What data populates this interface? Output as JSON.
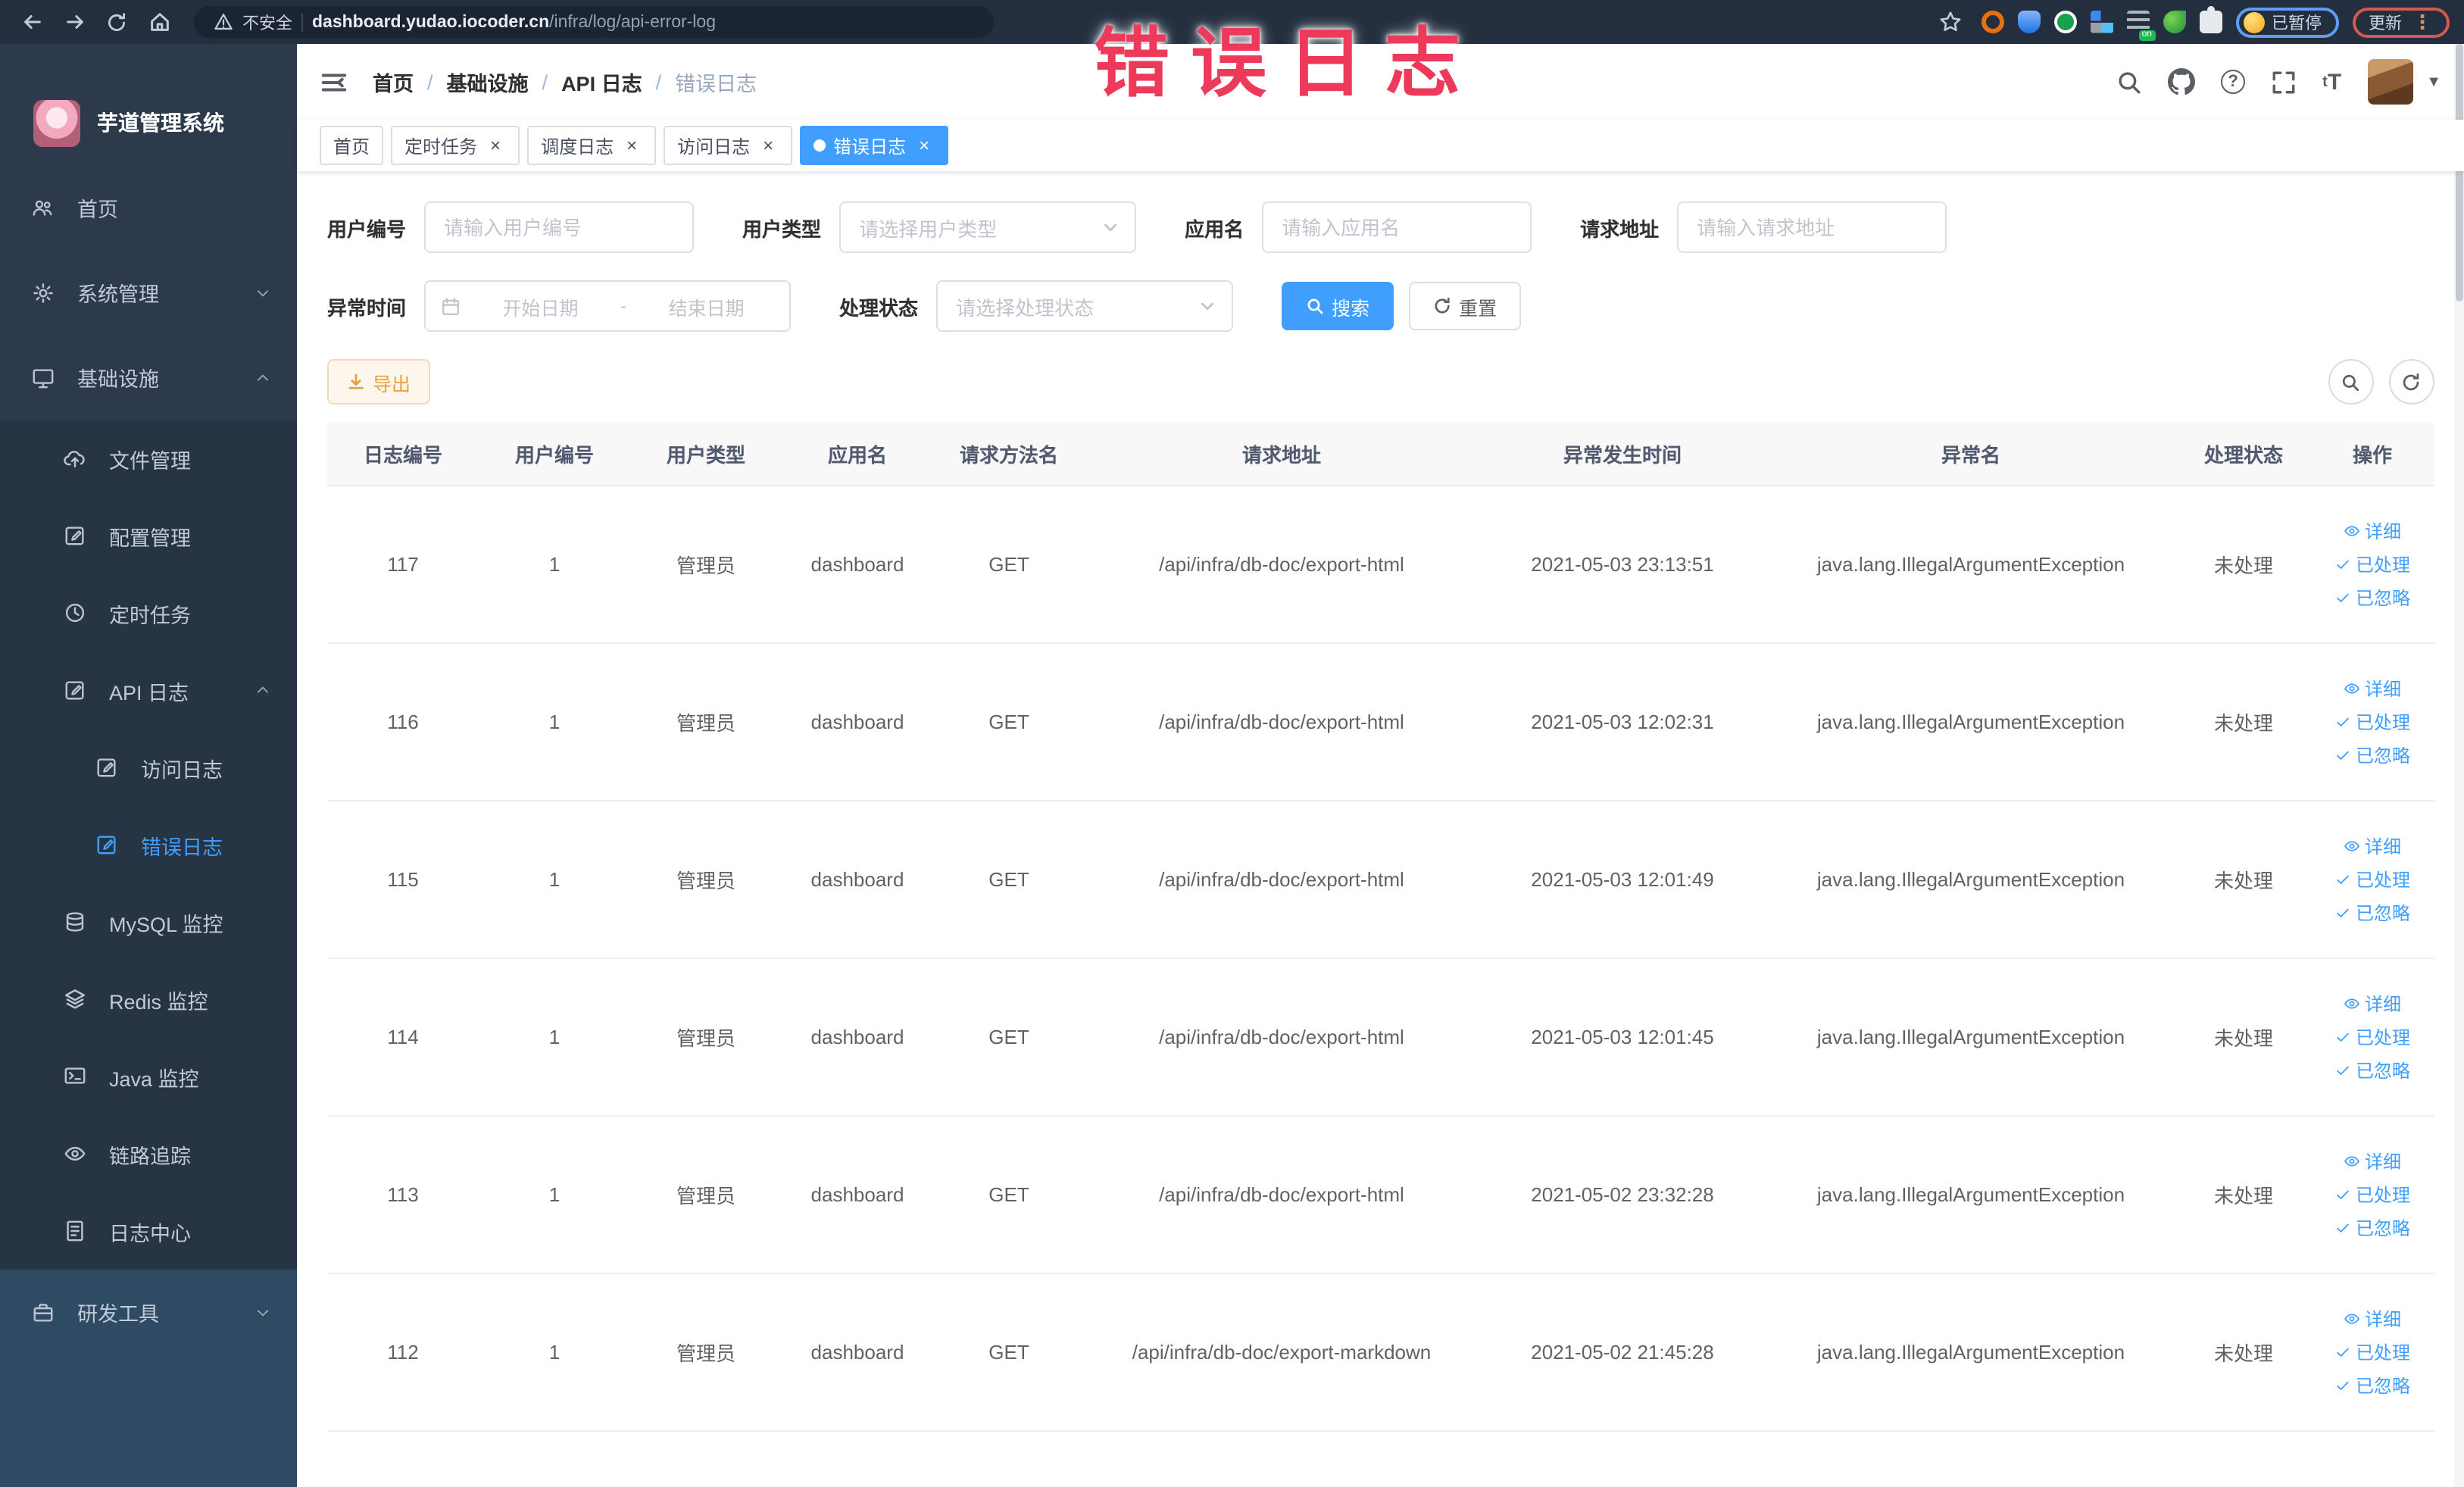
{
  "browser": {
    "security_label": "不安全",
    "url_domain": "dashboard.yudao.iocoder.cn",
    "url_path": "/infra/log/api-error-log",
    "paused_badge": "已暂停",
    "update_label": "更新"
  },
  "annotation": {
    "text": "错误日志",
    "color": "#ed3a5a"
  },
  "colors": {
    "accent": "#409eff",
    "sidebar_bg": "#2c3a4b",
    "submenu_bg": "#263444",
    "warning": "#e6a23c"
  },
  "sidebar": {
    "logo_title": "芋道管理系统",
    "items": [
      {
        "key": "home",
        "label": "首页",
        "icon": "people-icon",
        "level": 0
      },
      {
        "key": "system",
        "label": "系统管理",
        "icon": "gear-icon",
        "level": 0,
        "arrow": "down"
      },
      {
        "key": "infra",
        "label": "基础设施",
        "icon": "monitor-icon",
        "level": 0,
        "arrow": "up"
      },
      {
        "key": "file",
        "label": "文件管理",
        "icon": "cloud-upload-icon",
        "level": 1,
        "group": "infra"
      },
      {
        "key": "config",
        "label": "配置管理",
        "icon": "edit-icon",
        "level": 1,
        "group": "infra"
      },
      {
        "key": "job",
        "label": "定时任务",
        "icon": "clock-icon",
        "level": 1,
        "group": "infra"
      },
      {
        "key": "api-log",
        "label": "API 日志",
        "icon": "edit-icon",
        "level": 1,
        "group": "infra",
        "arrow": "up"
      },
      {
        "key": "access-log",
        "label": "访问日志",
        "icon": "edit-icon",
        "level": 2,
        "group": "infra"
      },
      {
        "key": "error-log",
        "label": "错误日志",
        "icon": "edit-icon",
        "level": 2,
        "group": "infra",
        "active": true
      },
      {
        "key": "mysql",
        "label": "MySQL 监控",
        "icon": "database-icon",
        "level": 1,
        "group": "infra"
      },
      {
        "key": "redis",
        "label": "Redis 监控",
        "icon": "layers-icon",
        "level": 1,
        "group": "infra"
      },
      {
        "key": "java",
        "label": "Java 监控",
        "icon": "terminal-icon",
        "level": 1,
        "group": "infra"
      },
      {
        "key": "tracer",
        "label": "链路追踪",
        "icon": "eye-icon",
        "level": 1,
        "group": "infra"
      },
      {
        "key": "log-center",
        "label": "日志中心",
        "icon": "document-icon",
        "level": 1,
        "group": "infra"
      },
      {
        "key": "dev-tools",
        "label": "研发工具",
        "icon": "toolbox-icon",
        "level": 0,
        "arrow": "down",
        "highlight": true
      }
    ]
  },
  "navbar": {
    "breadcrumb": [
      "首页",
      "基础设施",
      "API 日志",
      "错误日志"
    ]
  },
  "tags": [
    {
      "label": "首页",
      "closable": false,
      "active": false
    },
    {
      "label": "定时任务",
      "closable": true,
      "active": false
    },
    {
      "label": "调度日志",
      "closable": true,
      "active": false
    },
    {
      "label": "访问日志",
      "closable": true,
      "active": false
    },
    {
      "label": "错误日志",
      "closable": true,
      "active": true
    }
  ],
  "filters": {
    "user_id": {
      "label": "用户编号",
      "placeholder": "请输入用户编号"
    },
    "user_type": {
      "label": "用户类型",
      "placeholder": "请选择用户类型"
    },
    "app_name": {
      "label": "应用名",
      "placeholder": "请输入应用名"
    },
    "request_url": {
      "label": "请求地址",
      "placeholder": "请输入请求地址"
    },
    "exception_time": {
      "label": "异常时间",
      "start_placeholder": "开始日期",
      "separator": "-",
      "end_placeholder": "结束日期"
    },
    "process_status": {
      "label": "处理状态",
      "placeholder": "请选择处理状态"
    },
    "search_button": "搜索",
    "reset_button": "重置"
  },
  "toolbar": {
    "export_label": "导出"
  },
  "table": {
    "columns": [
      "日志编号",
      "用户编号",
      "用户类型",
      "应用名",
      "请求方法名",
      "请求地址",
      "异常发生时间",
      "异常名",
      "处理状态",
      "操作"
    ],
    "action_labels": [
      "详细",
      "已处理",
      "已忽略"
    ],
    "rows": [
      {
        "log_id": "117",
        "user_id": "1",
        "user_type": "管理员",
        "app_name": "dashboard",
        "method": "GET",
        "request_url": "/api/infra/db-doc/export-html",
        "time": "2021-05-03 23:13:51",
        "exception": "java.lang.IllegalArgumentException",
        "status": "未处理"
      },
      {
        "log_id": "116",
        "user_id": "1",
        "user_type": "管理员",
        "app_name": "dashboard",
        "method": "GET",
        "request_url": "/api/infra/db-doc/export-html",
        "time": "2021-05-03 12:02:31",
        "exception": "java.lang.IllegalArgumentException",
        "status": "未处理"
      },
      {
        "log_id": "115",
        "user_id": "1",
        "user_type": "管理员",
        "app_name": "dashboard",
        "method": "GET",
        "request_url": "/api/infra/db-doc/export-html",
        "time": "2021-05-03 12:01:49",
        "exception": "java.lang.IllegalArgumentException",
        "status": "未处理"
      },
      {
        "log_id": "114",
        "user_id": "1",
        "user_type": "管理员",
        "app_name": "dashboard",
        "method": "GET",
        "request_url": "/api/infra/db-doc/export-html",
        "time": "2021-05-03 12:01:45",
        "exception": "java.lang.IllegalArgumentException",
        "status": "未处理"
      },
      {
        "log_id": "113",
        "user_id": "1",
        "user_type": "管理员",
        "app_name": "dashboard",
        "method": "GET",
        "request_url": "/api/infra/db-doc/export-html",
        "time": "2021-05-02 23:32:28",
        "exception": "java.lang.IllegalArgumentException",
        "status": "未处理"
      },
      {
        "log_id": "112",
        "user_id": "1",
        "user_type": "管理员",
        "app_name": "dashboard",
        "method": "GET",
        "request_url": "/api/infra/db-doc/export-markdown",
        "time": "2021-05-02 21:45:28",
        "exception": "java.lang.IllegalArgumentException",
        "status": "未处理"
      }
    ]
  }
}
